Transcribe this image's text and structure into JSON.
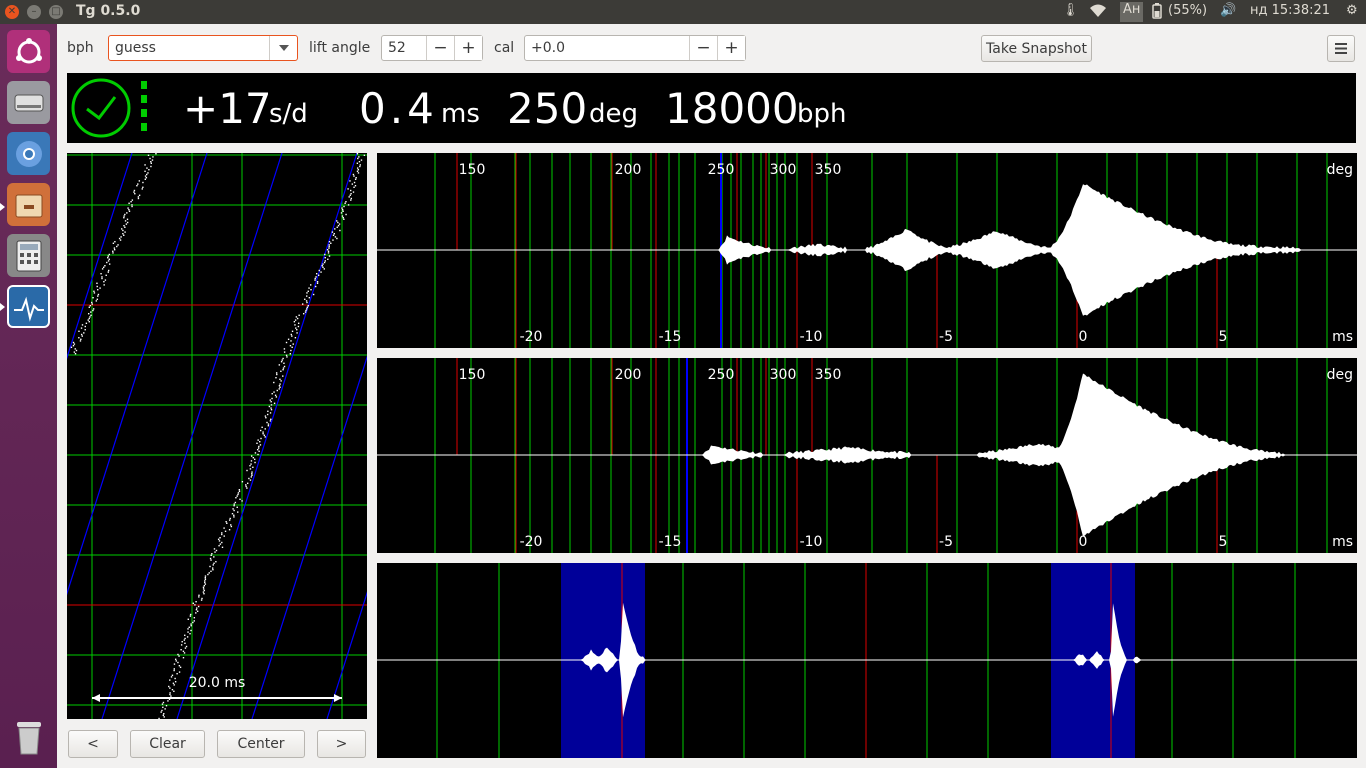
{
  "window": {
    "title": "Tg 0.5.0"
  },
  "tray": {
    "keyboard": "Ан",
    "battery": "(55%)",
    "clock": "нд 15:38:21"
  },
  "launcher": {
    "items": [
      "ubuntu-dash",
      "disk-files",
      "chromium",
      "file-manager",
      "calculator",
      "tg-app"
    ]
  },
  "toolbar": {
    "bph_label": "bph",
    "bph_value": "guess",
    "lift_label": "lift angle",
    "lift_value": "52",
    "cal_label": "cal",
    "cal_value": "+0.0",
    "minus": "−",
    "plus": "+",
    "snapshot_label": "Take Snapshot",
    "menu_icon": "hamburger-menu-icon"
  },
  "status": {
    "rate": "+17",
    "rate_unit": "s/d",
    "beat_error": "0.4",
    "beat_error_unit": "ms",
    "amplitude": "250",
    "amplitude_unit": "deg",
    "bph": "18000",
    "bph_unit": "bph"
  },
  "paperstrip": {
    "scale_label": "20.0 ms"
  },
  "nav": {
    "prev": "<",
    "clear": "Clear",
    "center": "Center",
    "next": ">"
  },
  "waveform": {
    "deg_unit": "deg",
    "ms_unit": "ms",
    "deg_ticks": [
      "150",
      "200",
      "250",
      "300",
      "350"
    ],
    "ms_ticks": [
      "-20",
      "-15",
      "-10",
      "-5",
      "0",
      "5"
    ]
  },
  "colors": {
    "grid": "#00cc00",
    "marker_red": "#dd0000",
    "marker_blue": "#0000ff",
    "highlight": "#000099",
    "accent": "#e9541f"
  }
}
